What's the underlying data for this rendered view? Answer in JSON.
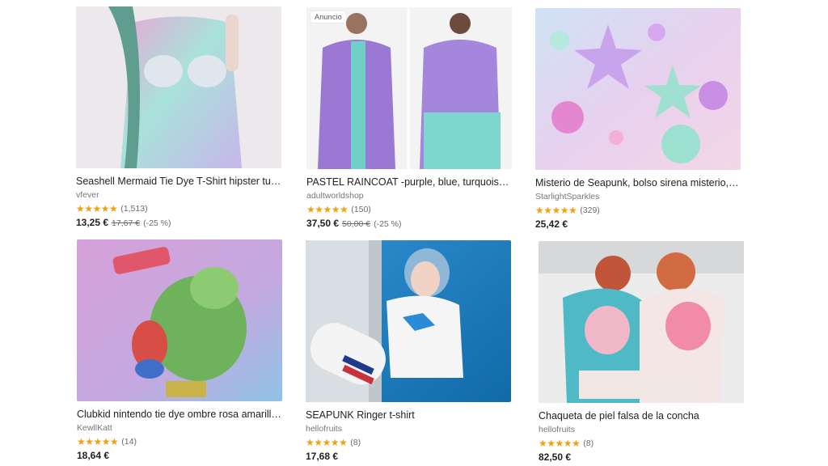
{
  "listings": [
    {
      "title": "Seashell Mermaid Tie Dye T-Shirt hipster tumblr",
      "shop": "vfever",
      "stars": "★★★★★",
      "reviews": "(1,513)",
      "price": "13,25 €",
      "original_price": "17,67 €",
      "discount": "(-25 %)",
      "ad_label": ""
    },
    {
      "title": "PASTEL RAINCOAT -purple, blue, turquoise, colorblock",
      "shop": "adultworldshop",
      "stars": "★★★★★",
      "reviews": "(150)",
      "price": "37,50 €",
      "original_price": "50,00 €",
      "discount": "(-25 %)",
      "ad_label": "Anuncio"
    },
    {
      "title": "Misterio de Seapunk, bolso sirena misterio, Pokemon",
      "shop": "StarlightSparkles",
      "stars": "★★★★★",
      "reviews": "(329)",
      "price": "25,42 €",
      "original_price": "",
      "discount": "",
      "ad_label": ""
    },
    {
      "title": "Clubkid nintendo tie dye ombre rosa amarillo yoshi",
      "shop": "KewllKatt",
      "stars": "★★★★★",
      "reviews": "(14)",
      "price": "18,64 €",
      "original_price": "",
      "discount": "",
      "ad_label": ""
    },
    {
      "title": "SEAPUNK Ringer t-shirt",
      "shop": "hellofruits",
      "stars": "★★★★★",
      "reviews": "(8)",
      "price": "17,68 €",
      "original_price": "",
      "discount": "",
      "ad_label": ""
    },
    {
      "title": "Chaqueta de piel falsa de la concha",
      "shop": "hellofruits",
      "stars": "★★★★★",
      "reviews": "(8)",
      "price": "82,50 €",
      "original_price": "",
      "discount": "",
      "ad_label": ""
    }
  ],
  "colors": {
    "star": "#f1a10d",
    "title": "#222222",
    "meta": "#777777"
  }
}
